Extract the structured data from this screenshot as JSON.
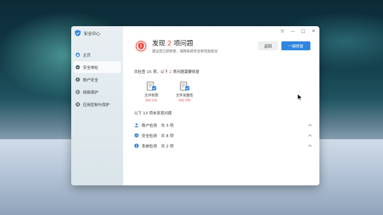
{
  "app": {
    "title": "安全中心"
  },
  "sidebar": {
    "items": [
      {
        "label": "主页",
        "icon": "home-icon"
      },
      {
        "label": "安全体检",
        "icon": "shield-check-icon"
      },
      {
        "label": "账户安全",
        "icon": "user-icon"
      },
      {
        "label": "网络保护",
        "icon": "globe-icon"
      },
      {
        "label": "应用控制与保护",
        "icon": "apps-icon"
      }
    ],
    "active_index": 1
  },
  "window_controls": {
    "menu": "≡",
    "minimize": "—",
    "maximize": "□",
    "close": "✕"
  },
  "header": {
    "title_prefix": "发现",
    "count": "2",
    "title_suffix": "项问题",
    "subtitle": "建议您立即修复，保障系统安全和性能稳定",
    "back_label": "返回",
    "fix_label": "一键修复"
  },
  "summary": {
    "prefix": "共检查 15 项，以下",
    "count": "2",
    "suffix": "项问题需要修复"
  },
  "issues": [
    {
      "label": "文件权限",
      "sub": "风险 (15)"
    },
    {
      "label": "文件完整性",
      "sub": "风险 (99)"
    }
  ],
  "no_problem": {
    "heading": "以下 13 项未发现问题"
  },
  "checks": [
    {
      "label": "账户检测",
      "count": "共 3 项",
      "icon": "user-icon"
    },
    {
      "label": "安全检测",
      "count": "共 8 项",
      "icon": "shield-icon"
    },
    {
      "label": "系统检测",
      "count": "共 2 项",
      "icon": "info-icon"
    }
  ],
  "colors": {
    "accent": "#2e86de",
    "danger": "#e8453c"
  }
}
